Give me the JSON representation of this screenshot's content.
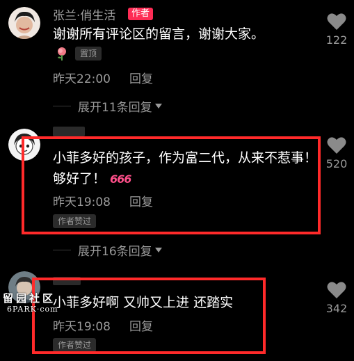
{
  "comments": [
    {
      "username": "张兰·俏生活",
      "author_badge": "作者",
      "text": "谢谢所有评论区的留言，谢谢大家。",
      "pinned_label": "置顶",
      "time": "昨天22:00",
      "reply_label": "回复",
      "likes": "122",
      "expand_label": "展开11条回复"
    },
    {
      "text": "小菲多好的孩子，作为富二代，从来不惹事！够好了！",
      "emoji_text": "666",
      "time": "昨天19:08",
      "reply_label": "回复",
      "tag": "作者赞过",
      "likes": "520",
      "expand_label": "展开16条回复"
    },
    {
      "text": "小菲多好啊 又帅又上进 还踏实",
      "time": "昨天19:08",
      "reply_label": "回复",
      "tag": "作者赞过",
      "likes": "342"
    }
  ],
  "watermark": {
    "cn": "留园社区",
    "en": "6PARK·com"
  },
  "colors": {
    "background": "#000000",
    "highlight": "#ff2a2a",
    "author_badge": "#fe2c55",
    "meta_text": "#9a9a9a"
  },
  "icons": [
    "heart-icon",
    "rose-emoji",
    "expand-triangle-icon"
  ]
}
